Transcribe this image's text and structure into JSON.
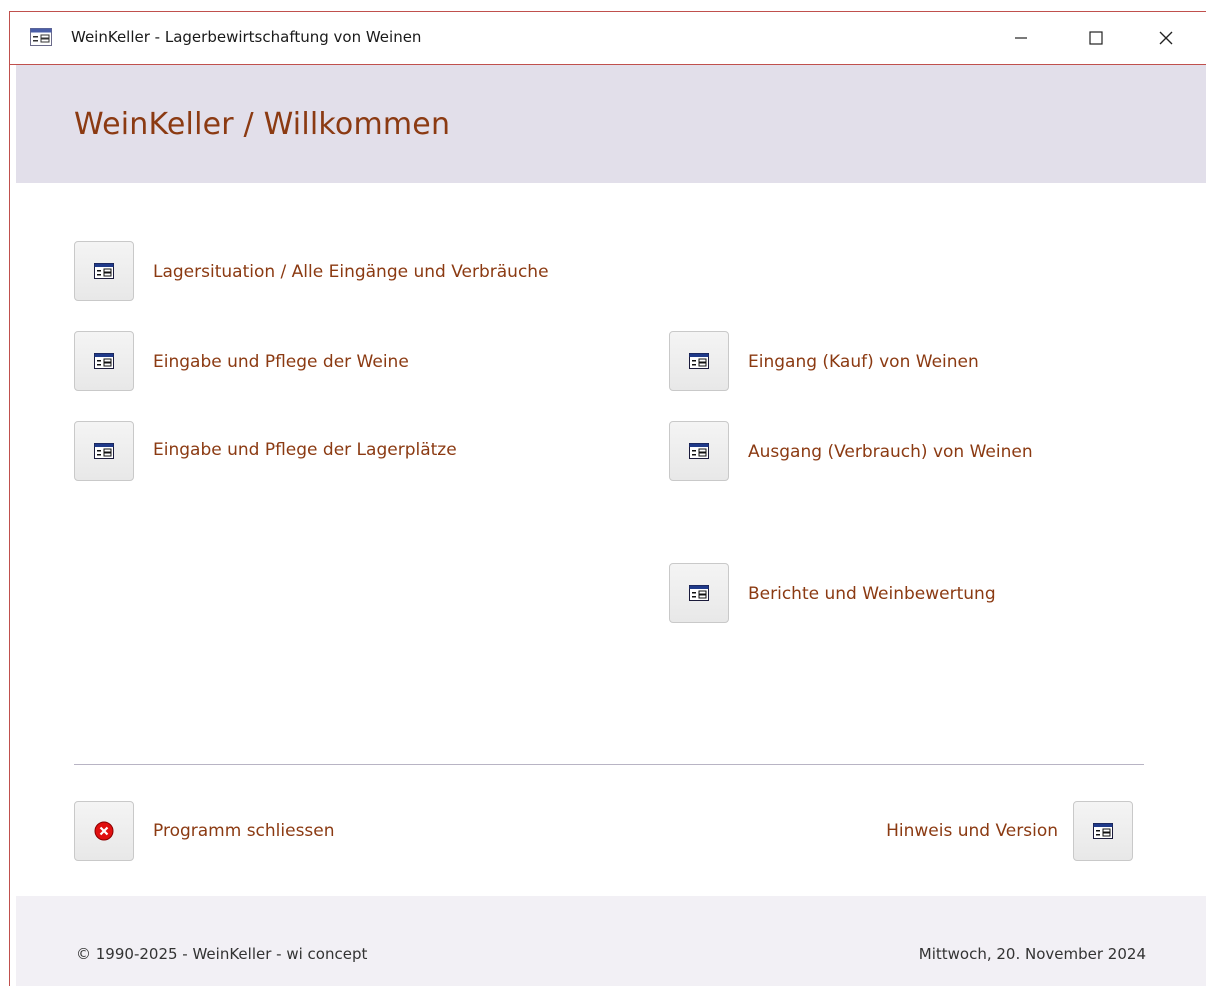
{
  "window": {
    "title": "WeinKeller - Lagerbewirtschaftung von Weinen",
    "controls": {
      "minimize": "—",
      "maximize": "☐",
      "close": "✕"
    }
  },
  "header": {
    "title": "WeinKeller / Willkommen"
  },
  "menu": {
    "lagersituation": "Lagersituation / Alle Eingänge und Verbräuche",
    "weine": "Eingabe und Pflege der Weine",
    "lagerplaetze": "Eingabe und Pflege der Lagerplätze",
    "eingang": "Eingang (Kauf) von Weinen",
    "ausgang": "Ausgang (Verbrauch) von Weinen",
    "berichte": "Berichte und Weinbewertung"
  },
  "actions": {
    "close_program": "Programm schliessen",
    "info_version": "Hinweis und Version"
  },
  "footer": {
    "copyright": "© 1990-2025 - WeinKeller - wi concept",
    "date": "Mittwoch, 20. November 2024"
  },
  "colors": {
    "accent": "#8b3a12",
    "header_bg": "#e2dfea",
    "footer_bg": "#f2f0f5",
    "window_border": "#c0504d"
  },
  "icons": {
    "form": "form-icon",
    "close": "close-circle-icon"
  }
}
